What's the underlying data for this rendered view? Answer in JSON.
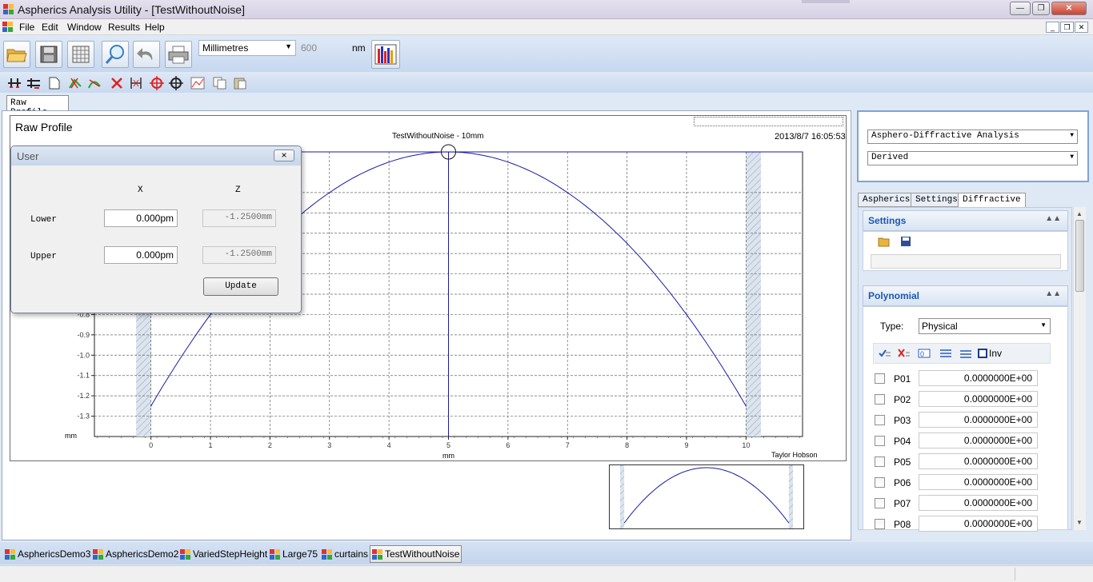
{
  "window": {
    "title": "Aspherics Analysis Utility - [TestWithoutNoise]"
  },
  "menu": [
    "File",
    "Edit",
    "Window",
    "Results",
    "Help"
  ],
  "toolbar": {
    "units": "Millimetres",
    "wavelength": "600",
    "wavelength_unit": "nm",
    "big_icons": [
      "open-folder-icon",
      "save-icon",
      "grid-icon",
      "zoom-icon",
      "undo-icon",
      "print-icon",
      "bar-chart-icon"
    ],
    "small_icons": [
      "level-icon",
      "level-alt-icon",
      "new-page-icon",
      "add-points-icon",
      "fit-icon",
      "delete-points-icon",
      "range-icon",
      "crosshair-icon",
      "crosshair-alt-icon",
      "graph-icon",
      "copy-icon",
      "paste-icon"
    ]
  },
  "document_tab": "Raw Profile",
  "chart_header": {
    "heading": "Raw Profile",
    "subtitle": "TestWithoutNoise - 10mm",
    "timestamp": "2013/8/7 16:05:53",
    "credit": "Taylor Hobson"
  },
  "user_dialog": {
    "title": "User",
    "close": "×",
    "col_x": "X",
    "col_z": "Z",
    "lower_label": "Lower",
    "upper_label": "Upper",
    "lower_x": "0.000pm",
    "lower_z": "-1.2500mm",
    "upper_x": "0.000pm",
    "upper_z": "-1.2500mm",
    "update_button": "Update"
  },
  "chart_data": {
    "type": "line",
    "xlabel": "mm",
    "ylabel": "mm",
    "xlim": [
      -0.95,
      10.95
    ],
    "ylim": [
      -1.4,
      0.0
    ],
    "x_ticks": [
      0,
      1,
      2,
      3,
      4,
      5,
      6,
      7,
      8,
      9,
      10
    ],
    "y_ticks": [
      -0.8,
      -0.9,
      -1.0,
      -1.1,
      -1.2,
      -1.3
    ],
    "y_tick_labels": [
      "-0.8",
      "-0.9",
      "-1.0",
      "-1.1",
      "-1.2",
      "-1.3"
    ],
    "series": [
      {
        "x": [
          0,
          1,
          2,
          3,
          4,
          5,
          6,
          7,
          8,
          9,
          10
        ],
        "values": [
          -1.25,
          -0.8,
          -0.45,
          -0.2,
          -0.05,
          0.0,
          -0.05,
          -0.2,
          -0.45,
          -0.8,
          -1.25
        ]
      }
    ],
    "excluded_regions": [
      [
        -0.25,
        0.0
      ],
      [
        10.0,
        10.25
      ]
    ],
    "marker": {
      "x": 5,
      "y": 0.0
    },
    "grid": true
  },
  "right_panel": {
    "analysis_type": "Asphero-Diffractive Analysis",
    "mode": "Derived",
    "tabs": [
      "Aspherics",
      "Settings",
      "Diffractive"
    ],
    "settings_header": "Settings",
    "polynomial_header": "Polynomial",
    "type_label": "Type:",
    "type_value": "Physical",
    "inv_label": "Inv",
    "coefficients": [
      {
        "name": "P01",
        "value": "0.0000000E+00"
      },
      {
        "name": "P02",
        "value": "0.0000000E+00"
      },
      {
        "name": "P03",
        "value": "0.0000000E+00"
      },
      {
        "name": "P04",
        "value": "0.0000000E+00"
      },
      {
        "name": "P05",
        "value": "0.0000000E+00"
      },
      {
        "name": "P06",
        "value": "0.0000000E+00"
      },
      {
        "name": "P07",
        "value": "0.0000000E+00"
      },
      {
        "name": "P08",
        "value": "0.0000000E+00"
      }
    ]
  },
  "bottom_tabs": [
    "AsphericsDemo3",
    "AsphericsDemo2",
    "VariedStepHeight",
    "Large75",
    "curtains",
    "TestWithoutNoise"
  ],
  "colors": {
    "curve": "#1a1aa8",
    "accent": "#1c57b5",
    "hatch": "#b8c6d8"
  }
}
